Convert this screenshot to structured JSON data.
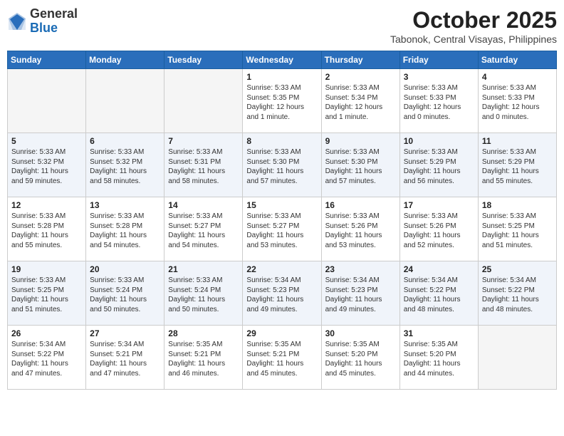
{
  "header": {
    "logo": {
      "general": "General",
      "blue": "Blue"
    },
    "month": "October 2025",
    "location": "Tabonok, Central Visayas, Philippines"
  },
  "weekdays": [
    "Sunday",
    "Monday",
    "Tuesday",
    "Wednesday",
    "Thursday",
    "Friday",
    "Saturday"
  ],
  "weeks": [
    [
      {
        "day": "",
        "info": ""
      },
      {
        "day": "",
        "info": ""
      },
      {
        "day": "",
        "info": ""
      },
      {
        "day": "1",
        "info": "Sunrise: 5:33 AM\nSunset: 5:35 PM\nDaylight: 12 hours\nand 1 minute."
      },
      {
        "day": "2",
        "info": "Sunrise: 5:33 AM\nSunset: 5:34 PM\nDaylight: 12 hours\nand 1 minute."
      },
      {
        "day": "3",
        "info": "Sunrise: 5:33 AM\nSunset: 5:33 PM\nDaylight: 12 hours\nand 0 minutes."
      },
      {
        "day": "4",
        "info": "Sunrise: 5:33 AM\nSunset: 5:33 PM\nDaylight: 12 hours\nand 0 minutes."
      }
    ],
    [
      {
        "day": "5",
        "info": "Sunrise: 5:33 AM\nSunset: 5:32 PM\nDaylight: 11 hours\nand 59 minutes."
      },
      {
        "day": "6",
        "info": "Sunrise: 5:33 AM\nSunset: 5:32 PM\nDaylight: 11 hours\nand 58 minutes."
      },
      {
        "day": "7",
        "info": "Sunrise: 5:33 AM\nSunset: 5:31 PM\nDaylight: 11 hours\nand 58 minutes."
      },
      {
        "day": "8",
        "info": "Sunrise: 5:33 AM\nSunset: 5:30 PM\nDaylight: 11 hours\nand 57 minutes."
      },
      {
        "day": "9",
        "info": "Sunrise: 5:33 AM\nSunset: 5:30 PM\nDaylight: 11 hours\nand 57 minutes."
      },
      {
        "day": "10",
        "info": "Sunrise: 5:33 AM\nSunset: 5:29 PM\nDaylight: 11 hours\nand 56 minutes."
      },
      {
        "day": "11",
        "info": "Sunrise: 5:33 AM\nSunset: 5:29 PM\nDaylight: 11 hours\nand 55 minutes."
      }
    ],
    [
      {
        "day": "12",
        "info": "Sunrise: 5:33 AM\nSunset: 5:28 PM\nDaylight: 11 hours\nand 55 minutes."
      },
      {
        "day": "13",
        "info": "Sunrise: 5:33 AM\nSunset: 5:28 PM\nDaylight: 11 hours\nand 54 minutes."
      },
      {
        "day": "14",
        "info": "Sunrise: 5:33 AM\nSunset: 5:27 PM\nDaylight: 11 hours\nand 54 minutes."
      },
      {
        "day": "15",
        "info": "Sunrise: 5:33 AM\nSunset: 5:27 PM\nDaylight: 11 hours\nand 53 minutes."
      },
      {
        "day": "16",
        "info": "Sunrise: 5:33 AM\nSunset: 5:26 PM\nDaylight: 11 hours\nand 53 minutes."
      },
      {
        "day": "17",
        "info": "Sunrise: 5:33 AM\nSunset: 5:26 PM\nDaylight: 11 hours\nand 52 minutes."
      },
      {
        "day": "18",
        "info": "Sunrise: 5:33 AM\nSunset: 5:25 PM\nDaylight: 11 hours\nand 51 minutes."
      }
    ],
    [
      {
        "day": "19",
        "info": "Sunrise: 5:33 AM\nSunset: 5:25 PM\nDaylight: 11 hours\nand 51 minutes."
      },
      {
        "day": "20",
        "info": "Sunrise: 5:33 AM\nSunset: 5:24 PM\nDaylight: 11 hours\nand 50 minutes."
      },
      {
        "day": "21",
        "info": "Sunrise: 5:33 AM\nSunset: 5:24 PM\nDaylight: 11 hours\nand 50 minutes."
      },
      {
        "day": "22",
        "info": "Sunrise: 5:34 AM\nSunset: 5:23 PM\nDaylight: 11 hours\nand 49 minutes."
      },
      {
        "day": "23",
        "info": "Sunrise: 5:34 AM\nSunset: 5:23 PM\nDaylight: 11 hours\nand 49 minutes."
      },
      {
        "day": "24",
        "info": "Sunrise: 5:34 AM\nSunset: 5:22 PM\nDaylight: 11 hours\nand 48 minutes."
      },
      {
        "day": "25",
        "info": "Sunrise: 5:34 AM\nSunset: 5:22 PM\nDaylight: 11 hours\nand 48 minutes."
      }
    ],
    [
      {
        "day": "26",
        "info": "Sunrise: 5:34 AM\nSunset: 5:22 PM\nDaylight: 11 hours\nand 47 minutes."
      },
      {
        "day": "27",
        "info": "Sunrise: 5:34 AM\nSunset: 5:21 PM\nDaylight: 11 hours\nand 47 minutes."
      },
      {
        "day": "28",
        "info": "Sunrise: 5:35 AM\nSunset: 5:21 PM\nDaylight: 11 hours\nand 46 minutes."
      },
      {
        "day": "29",
        "info": "Sunrise: 5:35 AM\nSunset: 5:21 PM\nDaylight: 11 hours\nand 45 minutes."
      },
      {
        "day": "30",
        "info": "Sunrise: 5:35 AM\nSunset: 5:20 PM\nDaylight: 11 hours\nand 45 minutes."
      },
      {
        "day": "31",
        "info": "Sunrise: 5:35 AM\nSunset: 5:20 PM\nDaylight: 11 hours\nand 44 minutes."
      },
      {
        "day": "",
        "info": ""
      }
    ]
  ]
}
